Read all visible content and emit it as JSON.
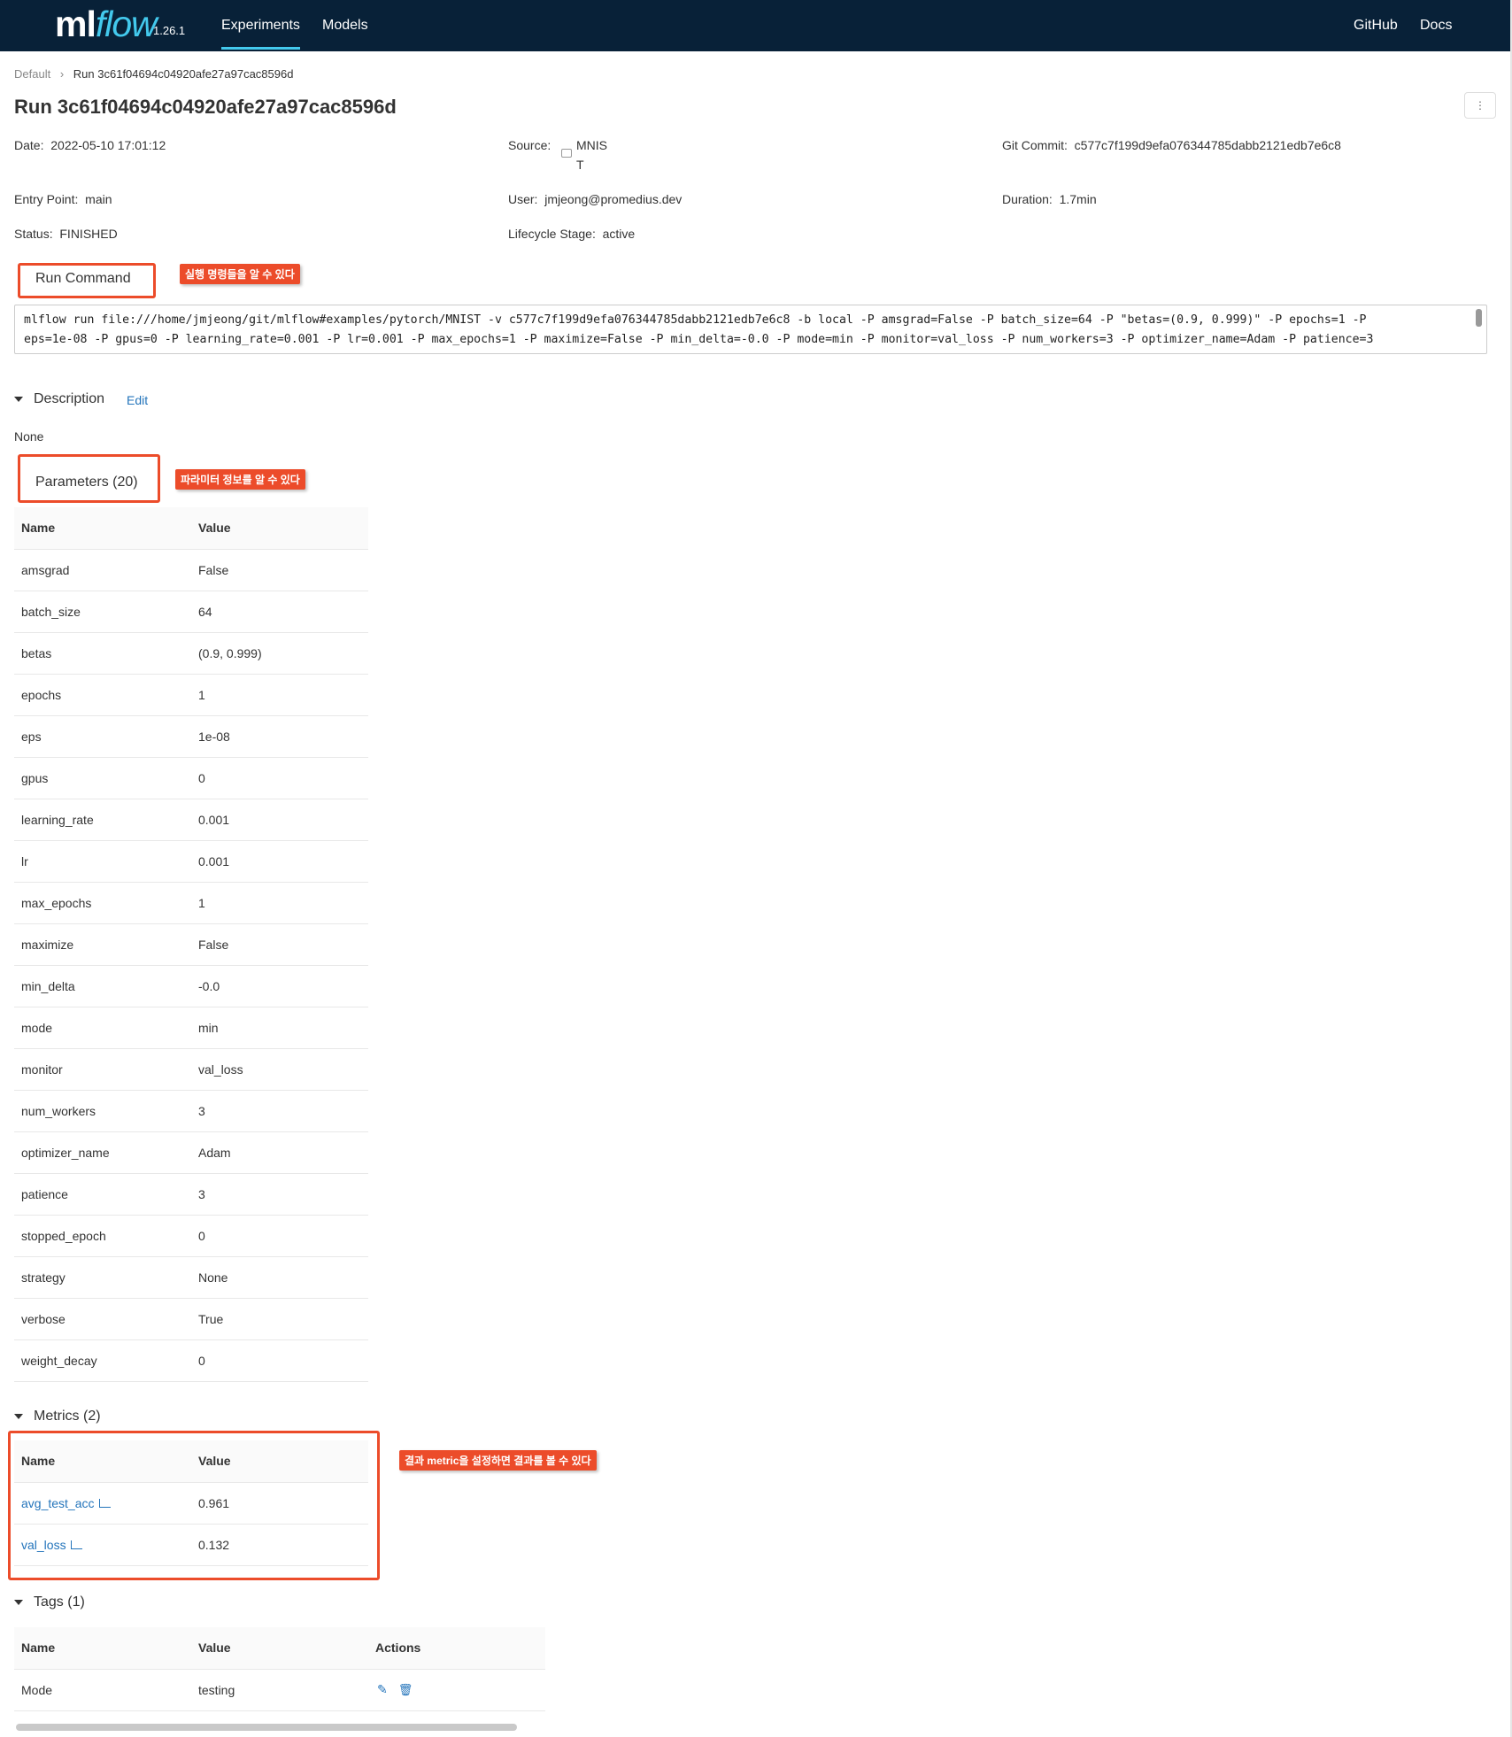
{
  "header": {
    "logo_ml": "ml",
    "logo_flow": "flow",
    "version": "1.26.1",
    "nav_left": [
      "Experiments",
      "Models"
    ],
    "nav_right": [
      "GitHub",
      "Docs"
    ]
  },
  "breadcrumb": {
    "root": "Default",
    "current": "Run 3c61f04694c04920afe27a97cac8596d"
  },
  "page_title": "Run 3c61f04694c04920afe27a97cac8596d",
  "meta": {
    "date_label": "Date:",
    "date": "2022-05-10 17:01:12",
    "source_label": "Source:",
    "source_line1": "MNIS",
    "source_line2": "T",
    "commit_label": "Git Commit:",
    "commit": "c577c7f199d9efa076344785dabb2121edb7e6c8",
    "entry_label": "Entry Point:",
    "entry": "main",
    "user_label": "User:",
    "user": "jmjeong@promedius.dev",
    "duration_label": "Duration:",
    "duration": "1.7min",
    "status_label": "Status:",
    "status": "FINISHED",
    "lifecycle_label": "Lifecycle Stage:",
    "lifecycle": "active"
  },
  "run_command": {
    "title": "Run Command",
    "note": "실행 명령들을 알 수 있다",
    "line1": "mlflow run file:///home/jmjeong/git/mlflow#examples/pytorch/MNIST -v c577c7f199d9efa076344785dabb2121edb7e6c8 -b local -P amsgrad=False -P batch_size=64 -P \"betas=(0.9, 0.999)\" -P epochs=1 -P",
    "line2": "eps=1e-08 -P gpus=0 -P learning_rate=0.001 -P lr=0.001 -P max_epochs=1 -P maximize=False -P min_delta=-0.0 -P mode=min -P monitor=val_loss -P num_workers=3 -P optimizer_name=Adam -P patience=3"
  },
  "description": {
    "title": "Description",
    "edit": "Edit",
    "value": "None"
  },
  "parameters": {
    "title": "Parameters (20)",
    "note": "파라미터 정보를 알 수 있다",
    "col_name": "Name",
    "col_value": "Value",
    "rows": [
      {
        "name": "amsgrad",
        "value": "False"
      },
      {
        "name": "batch_size",
        "value": "64"
      },
      {
        "name": "betas",
        "value": "(0.9, 0.999)"
      },
      {
        "name": "epochs",
        "value": "1"
      },
      {
        "name": "eps",
        "value": "1e-08"
      },
      {
        "name": "gpus",
        "value": "0"
      },
      {
        "name": "learning_rate",
        "value": "0.001"
      },
      {
        "name": "lr",
        "value": "0.001"
      },
      {
        "name": "max_epochs",
        "value": "1"
      },
      {
        "name": "maximize",
        "value": "False"
      },
      {
        "name": "min_delta",
        "value": "-0.0"
      },
      {
        "name": "mode",
        "value": "min"
      },
      {
        "name": "monitor",
        "value": "val_loss"
      },
      {
        "name": "num_workers",
        "value": "3"
      },
      {
        "name": "optimizer_name",
        "value": "Adam"
      },
      {
        "name": "patience",
        "value": "3"
      },
      {
        "name": "stopped_epoch",
        "value": "0"
      },
      {
        "name": "strategy",
        "value": "None"
      },
      {
        "name": "verbose",
        "value": "True"
      },
      {
        "name": "weight_decay",
        "value": "0"
      }
    ]
  },
  "metrics": {
    "title": "Metrics (2)",
    "note": "결과 metric을 설정하면 결과를 볼 수 있다",
    "col_name": "Name",
    "col_value": "Value",
    "rows": [
      {
        "name": "avg_test_acc",
        "value": "0.961"
      },
      {
        "name": "val_loss",
        "value": "0.132"
      }
    ]
  },
  "tags": {
    "title": "Tags (1)",
    "col_name": "Name",
    "col_value": "Value",
    "col_actions": "Actions",
    "rows": [
      {
        "name": "Mode",
        "value": "testing"
      }
    ],
    "icons": [
      "edit-icon",
      "delete-icon"
    ]
  },
  "colors": {
    "header_bg": "#082138",
    "accent": "#43c9ed",
    "annotation": "#ec4c2a",
    "link": "#2374bb"
  }
}
